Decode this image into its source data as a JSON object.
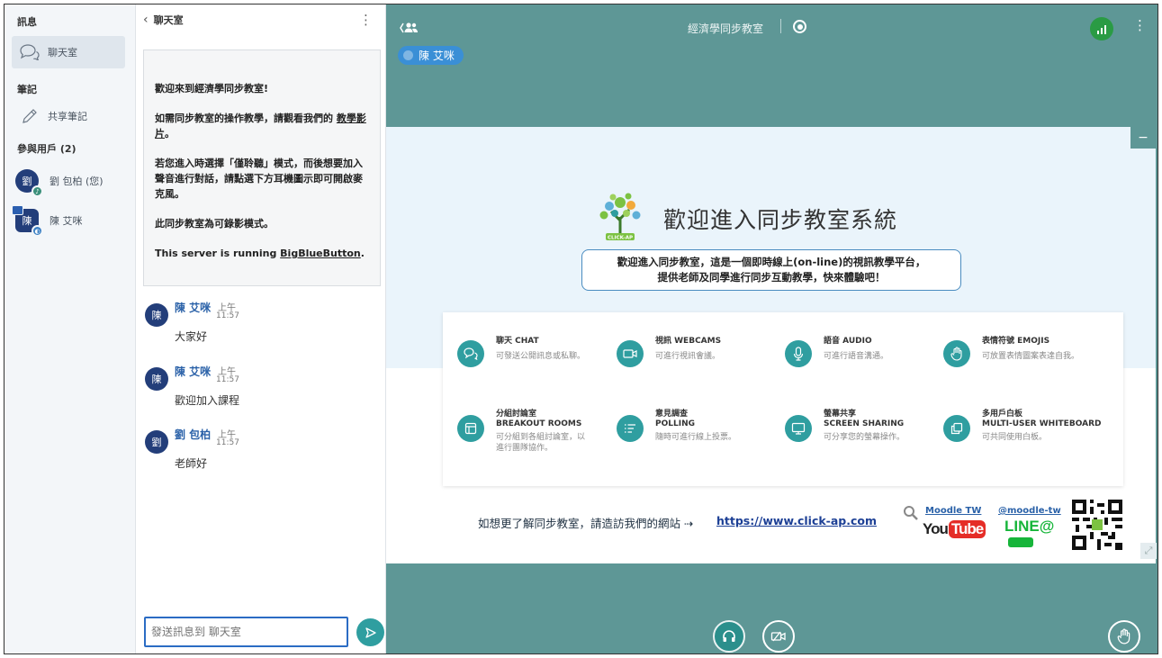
{
  "sidebar": {
    "messages_heading": "訊息",
    "chat_item": "聊天室",
    "notes_heading": "筆記",
    "shared_notes_item": "共享筆記",
    "users_heading": "參與用戶 (2)",
    "users": [
      {
        "initial": "劉",
        "name": "劉 包柏 (您)"
      },
      {
        "initial": "陳",
        "name": "陳 艾咪"
      }
    ]
  },
  "chat": {
    "back_label": "聊天室",
    "menu_icon": "more-vertical-icon",
    "welcome": {
      "line1": "歡迎來到經濟學同步教室!",
      "line2_prefix": "如需同步教室的操作教學，請觀看我們的 ",
      "line2_link": "教學影片",
      "line2_suffix": "。",
      "line3": "若您進入時選擇「僅聆聽」模式，而後想要加入聲音進行對話，請點選下方耳機圖示即可開啟麥克風。",
      "line4": "此同步教室為可錄影模式。",
      "line5_prefix": "This server is running ",
      "line5_link": "BigBlueButton",
      "line5_suffix": "."
    },
    "messages": [
      {
        "initial": "陳",
        "name": "陳 艾咪",
        "time_period": "上午",
        "time": "11:57",
        "text": "大家好"
      },
      {
        "initial": "陳",
        "name": "陳 艾咪",
        "time_period": "上午",
        "time": "11:57",
        "text": "歡迎加入課程"
      },
      {
        "initial": "劉",
        "name": "劉 包柏",
        "time_period": "上午",
        "time": "11:57",
        "text": "老師好"
      }
    ],
    "input_placeholder": "發送訊息到 聊天室"
  },
  "main": {
    "room_title": "經濟學同步教室",
    "speaker": "陳 艾咪",
    "minimize_label": "−",
    "slide": {
      "title": "歡迎進入同步教室系統",
      "logo_text": "CLICK-AP",
      "desc_line1": "歡迎進入同步教室，這是一個即時線上(on-line)的視訊教學平台，",
      "desc_line2": "提供老師及同學進行同步互動教學，快來體驗吧！",
      "features": [
        {
          "title1": "聊天 CHAT",
          "title2": "",
          "desc1": "可發送公開訊息或私聊。",
          "desc2": ""
        },
        {
          "title1": "視訊 WEBCAMS",
          "title2": "",
          "desc1": "可進行視訊會議。",
          "desc2": ""
        },
        {
          "title1": "語音 AUDIO",
          "title2": "",
          "desc1": "可進行語音溝通。",
          "desc2": ""
        },
        {
          "title1": "表情符號 EMOJIS",
          "title2": "",
          "desc1": "可放置表情圖案表達自我。",
          "desc2": ""
        },
        {
          "title1": "分組討論室",
          "title2": "BREAKOUT ROOMS",
          "desc1": "可分組到各組討論室，以",
          "desc2": "進行團隊協作。"
        },
        {
          "title1": "意見調查",
          "title2": "POLLING",
          "desc1": "隨時可進行線上投票。",
          "desc2": ""
        },
        {
          "title1": "螢幕共享",
          "title2": "SCREEN SHARING",
          "desc1": "可分享您的螢幕操作。",
          "desc2": ""
        },
        {
          "title1": "多用戶白板",
          "title2": "MULTI-USER WHITEBOARD",
          "desc1": "可共同使用白板。",
          "desc2": ""
        }
      ],
      "footer_text": "如想更了解同步教室，請造訪我們的網站 ⇢",
      "footer_link": "https://www.click-ap.com",
      "moodle_label": "Moodle TW",
      "youtube_you": "You",
      "youtube_tube": "Tube",
      "line_handle": "@moodle-tw",
      "line_logo": "LINE@"
    }
  },
  "colors": {
    "accent": "#2f9ea0",
    "main_bg": "#5e9796",
    "avatar": "#233e7a",
    "link": "#2a61a8"
  }
}
